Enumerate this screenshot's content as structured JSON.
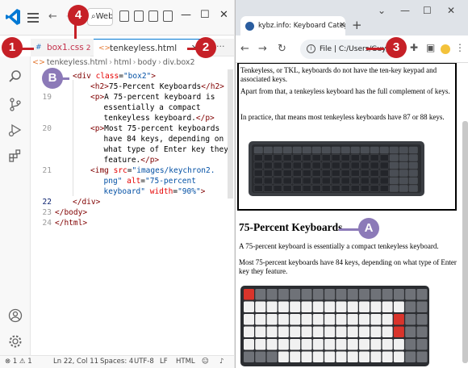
{
  "vscode": {
    "search_label": "Web...",
    "tabs": [
      {
        "label": "box1.css",
        "count": "2"
      },
      {
        "label": "tenkeyless.html"
      }
    ],
    "tab_more": "···",
    "breadcrumb": [
      "tenkeyless.html",
      "html",
      "body",
      "div.box2"
    ],
    "code_lines": [
      {
        "num": "",
        "tokens": [
          [
            "tg",
            "<div "
          ],
          [
            "at",
            "class"
          ],
          [
            "tx",
            "="
          ],
          [
            "vl",
            "\"box2\""
          ],
          [
            "tg",
            ">"
          ]
        ]
      },
      {
        "num": "",
        "tokens": [
          [
            "tg",
            "<h2>"
          ],
          [
            "tx",
            "75-Percent Keyboards"
          ],
          [
            "tg",
            "</h2>"
          ]
        ]
      },
      {
        "num": "19",
        "tokens": [
          [
            "tg",
            "<p>"
          ],
          [
            "tx",
            "A 75-percent keyboard is"
          ]
        ]
      },
      {
        "num": "",
        "tokens": [
          [
            "tx",
            "essentially a compact"
          ]
        ]
      },
      {
        "num": "",
        "tokens": [
          [
            "tx",
            "tenkeyless keyboard."
          ],
          [
            "tg",
            "</p>"
          ]
        ]
      },
      {
        "num": "20",
        "tokens": [
          [
            "tg",
            "<p>"
          ],
          [
            "tx",
            "Most 75-percent keyboards"
          ]
        ]
      },
      {
        "num": "",
        "tokens": [
          [
            "tx",
            "have 84 keys, depending on"
          ]
        ]
      },
      {
        "num": "",
        "tokens": [
          [
            "tx",
            "what type of Enter key they"
          ]
        ]
      },
      {
        "num": "",
        "tokens": [
          [
            "tx",
            "feature."
          ],
          [
            "tg",
            "</p>"
          ]
        ]
      },
      {
        "num": "21",
        "tokens": [
          [
            "tg",
            "<img "
          ],
          [
            "at",
            "src"
          ],
          [
            "tx",
            "="
          ],
          [
            "vl",
            "\"images/keychron2."
          ]
        ]
      },
      {
        "num": "",
        "tokens": [
          [
            "vl",
            "png\""
          ],
          [
            "tx",
            " "
          ],
          [
            "at",
            "alt"
          ],
          [
            "tx",
            "="
          ],
          [
            "vl",
            "\"75-percent"
          ]
        ]
      },
      {
        "num": "",
        "tokens": [
          [
            "vl",
            "keyboard\""
          ],
          [
            "tx",
            " "
          ],
          [
            "at",
            "width"
          ],
          [
            "tx",
            "="
          ],
          [
            "vl",
            "\"90%\""
          ],
          [
            "tg",
            ">"
          ]
        ]
      },
      {
        "num": "22",
        "tokens": [
          [
            "tg",
            "</div>"
          ]
        ]
      },
      {
        "num": "23",
        "tokens": [
          [
            "tg",
            "</body>"
          ]
        ]
      },
      {
        "num": "24",
        "tokens": [
          [
            "tg",
            "</html>"
          ]
        ]
      }
    ],
    "status": {
      "problems": "⊗ 1 ⚠ 1",
      "position": "Ln 22, Col 11",
      "spaces": "Spaces: 4",
      "encoding": "UTF-8",
      "eol": "LF",
      "language": "HTML"
    }
  },
  "browser": {
    "tab_title": "kybz.info: Keyboard Categories",
    "url": "File | C:/Users/Guy/Dro...",
    "page": {
      "para1": "Tenkeyless, or TKL, keyboards do not have the ten-key keypad and associated keys.",
      "para2": "Apart from that, a tenkeyless keyboard has the full complement of keys.",
      "para3": "In practice, that means most tenkeyless keyboards have 87 or 88 keys.",
      "heading": "75-Percent Keyboards",
      "para4": "A 75-percent keyboard is essentially a compact tenkeyless keyboard.",
      "para5": "Most 75-percent keyboards have 84 keys, depending on what type of Enter key they feature."
    }
  },
  "callouts": {
    "c1": "1",
    "c2": "2",
    "c3": "3",
    "c4": "4",
    "cA": "A",
    "cB": "B"
  },
  "colors": {
    "callout_red": "#c62027",
    "callout_purple": "#8c7ab8",
    "vscode_blue": "#0078d4"
  }
}
